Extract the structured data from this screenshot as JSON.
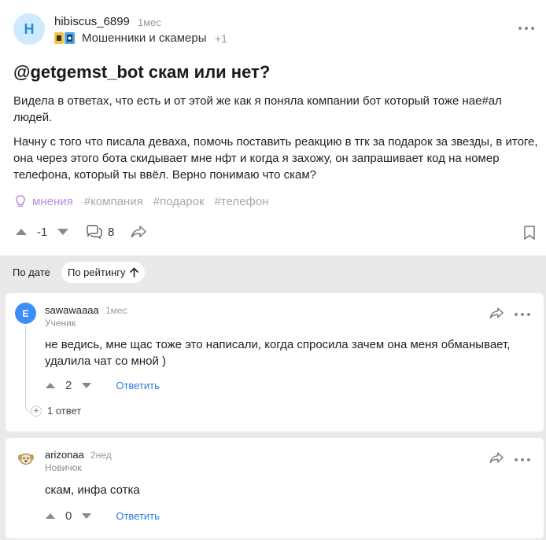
{
  "post": {
    "avatar_letter": "H",
    "username": "hibiscus_6899",
    "time": "1мес",
    "community": "Мошенники и скамеры",
    "community_extra": "+1",
    "title": "@getgemst_bot скам или нет?",
    "paragraphs": [
      "Видела в ответах, что есть и от этой же как я поняла компании бот который тоже нае#ал людей.",
      "Начну с того что писала деваха, помочь поставить реакцию в тгк за подарок за звезды, в итоге, она через этого бота скидывает мне нфт и когда я захожу, он запрашивает код на номер телефона, который ты ввёл. Верно понимаю что скам?"
    ],
    "tags": [
      "мнения",
      "#компания",
      "#подарок",
      "#телефон"
    ],
    "votes": "-1",
    "comments_count": "8"
  },
  "sort": {
    "by_date": "По дате",
    "by_rating": "По рейтингу"
  },
  "comments": [
    {
      "avatar_letter": "E",
      "username": "sawawaaaa",
      "time": "1мес",
      "rank": "Ученик",
      "text": "не ведись, мне щас тоже это написали, когда спросила зачем она меня обманывает, удалила чат со мной )",
      "votes": "2",
      "reply_label": "Ответить",
      "replies_label": "1 ответ"
    },
    {
      "username": "arizonaa",
      "time": "2нед",
      "rank": "Новичок",
      "text": "скам, инфа сотка",
      "votes": "0",
      "reply_label": "Ответить"
    }
  ],
  "colors": {
    "accent_blue": "#2a7ae2",
    "tag_purple": "#b88de0",
    "avatar_bg": "#cfe9ff",
    "comment_avatar": "#3e8ef7",
    "page_bg": "#e9e9eb"
  }
}
